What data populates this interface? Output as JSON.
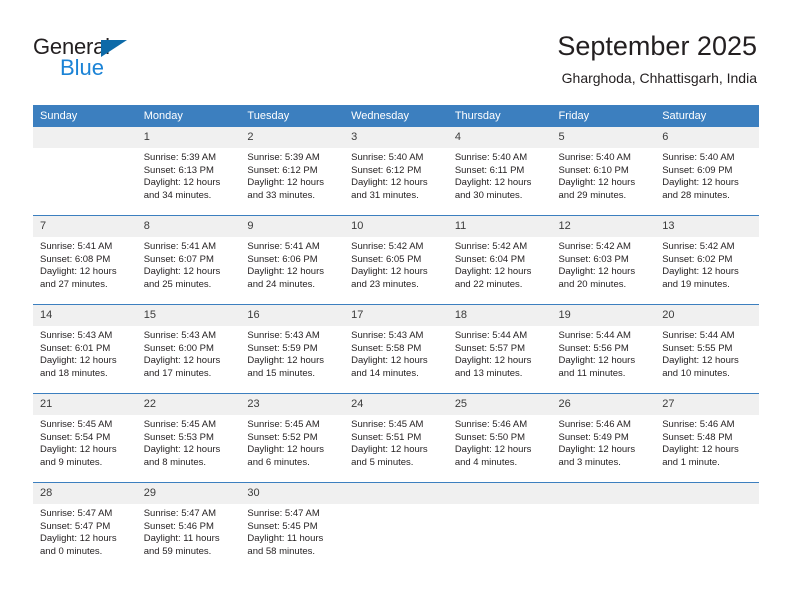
{
  "brand": {
    "name_part1": "General",
    "name_part2": "Blue",
    "accent_color": "#1b83d6",
    "triangle_color": "#0d6aa8"
  },
  "header": {
    "title": "September 2025",
    "subtitle": "Gharghoda, Chhattisgarh, India"
  },
  "calendar": {
    "header_bg": "#3c7fbf",
    "daynum_bg": "#f0f0f0",
    "weekday_headers": [
      "Sunday",
      "Monday",
      "Tuesday",
      "Wednesday",
      "Thursday",
      "Friday",
      "Saturday"
    ],
    "weeks": [
      [
        {
          "day": "",
          "sunrise": "",
          "sunset": "",
          "daylight1": "",
          "daylight2": ""
        },
        {
          "day": "1",
          "sunrise": "Sunrise: 5:39 AM",
          "sunset": "Sunset: 6:13 PM",
          "daylight1": "Daylight: 12 hours",
          "daylight2": "and 34 minutes."
        },
        {
          "day": "2",
          "sunrise": "Sunrise: 5:39 AM",
          "sunset": "Sunset: 6:12 PM",
          "daylight1": "Daylight: 12 hours",
          "daylight2": "and 33 minutes."
        },
        {
          "day": "3",
          "sunrise": "Sunrise: 5:40 AM",
          "sunset": "Sunset: 6:12 PM",
          "daylight1": "Daylight: 12 hours",
          "daylight2": "and 31 minutes."
        },
        {
          "day": "4",
          "sunrise": "Sunrise: 5:40 AM",
          "sunset": "Sunset: 6:11 PM",
          "daylight1": "Daylight: 12 hours",
          "daylight2": "and 30 minutes."
        },
        {
          "day": "5",
          "sunrise": "Sunrise: 5:40 AM",
          "sunset": "Sunset: 6:10 PM",
          "daylight1": "Daylight: 12 hours",
          "daylight2": "and 29 minutes."
        },
        {
          "day": "6",
          "sunrise": "Sunrise: 5:40 AM",
          "sunset": "Sunset: 6:09 PM",
          "daylight1": "Daylight: 12 hours",
          "daylight2": "and 28 minutes."
        }
      ],
      [
        {
          "day": "7",
          "sunrise": "Sunrise: 5:41 AM",
          "sunset": "Sunset: 6:08 PM",
          "daylight1": "Daylight: 12 hours",
          "daylight2": "and 27 minutes."
        },
        {
          "day": "8",
          "sunrise": "Sunrise: 5:41 AM",
          "sunset": "Sunset: 6:07 PM",
          "daylight1": "Daylight: 12 hours",
          "daylight2": "and 25 minutes."
        },
        {
          "day": "9",
          "sunrise": "Sunrise: 5:41 AM",
          "sunset": "Sunset: 6:06 PM",
          "daylight1": "Daylight: 12 hours",
          "daylight2": "and 24 minutes."
        },
        {
          "day": "10",
          "sunrise": "Sunrise: 5:42 AM",
          "sunset": "Sunset: 6:05 PM",
          "daylight1": "Daylight: 12 hours",
          "daylight2": "and 23 minutes."
        },
        {
          "day": "11",
          "sunrise": "Sunrise: 5:42 AM",
          "sunset": "Sunset: 6:04 PM",
          "daylight1": "Daylight: 12 hours",
          "daylight2": "and 22 minutes."
        },
        {
          "day": "12",
          "sunrise": "Sunrise: 5:42 AM",
          "sunset": "Sunset: 6:03 PM",
          "daylight1": "Daylight: 12 hours",
          "daylight2": "and 20 minutes."
        },
        {
          "day": "13",
          "sunrise": "Sunrise: 5:42 AM",
          "sunset": "Sunset: 6:02 PM",
          "daylight1": "Daylight: 12 hours",
          "daylight2": "and 19 minutes."
        }
      ],
      [
        {
          "day": "14",
          "sunrise": "Sunrise: 5:43 AM",
          "sunset": "Sunset: 6:01 PM",
          "daylight1": "Daylight: 12 hours",
          "daylight2": "and 18 minutes."
        },
        {
          "day": "15",
          "sunrise": "Sunrise: 5:43 AM",
          "sunset": "Sunset: 6:00 PM",
          "daylight1": "Daylight: 12 hours",
          "daylight2": "and 17 minutes."
        },
        {
          "day": "16",
          "sunrise": "Sunrise: 5:43 AM",
          "sunset": "Sunset: 5:59 PM",
          "daylight1": "Daylight: 12 hours",
          "daylight2": "and 15 minutes."
        },
        {
          "day": "17",
          "sunrise": "Sunrise: 5:43 AM",
          "sunset": "Sunset: 5:58 PM",
          "daylight1": "Daylight: 12 hours",
          "daylight2": "and 14 minutes."
        },
        {
          "day": "18",
          "sunrise": "Sunrise: 5:44 AM",
          "sunset": "Sunset: 5:57 PM",
          "daylight1": "Daylight: 12 hours",
          "daylight2": "and 13 minutes."
        },
        {
          "day": "19",
          "sunrise": "Sunrise: 5:44 AM",
          "sunset": "Sunset: 5:56 PM",
          "daylight1": "Daylight: 12 hours",
          "daylight2": "and 11 minutes."
        },
        {
          "day": "20",
          "sunrise": "Sunrise: 5:44 AM",
          "sunset": "Sunset: 5:55 PM",
          "daylight1": "Daylight: 12 hours",
          "daylight2": "and 10 minutes."
        }
      ],
      [
        {
          "day": "21",
          "sunrise": "Sunrise: 5:45 AM",
          "sunset": "Sunset: 5:54 PM",
          "daylight1": "Daylight: 12 hours",
          "daylight2": "and 9 minutes."
        },
        {
          "day": "22",
          "sunrise": "Sunrise: 5:45 AM",
          "sunset": "Sunset: 5:53 PM",
          "daylight1": "Daylight: 12 hours",
          "daylight2": "and 8 minutes."
        },
        {
          "day": "23",
          "sunrise": "Sunrise: 5:45 AM",
          "sunset": "Sunset: 5:52 PM",
          "daylight1": "Daylight: 12 hours",
          "daylight2": "and 6 minutes."
        },
        {
          "day": "24",
          "sunrise": "Sunrise: 5:45 AM",
          "sunset": "Sunset: 5:51 PM",
          "daylight1": "Daylight: 12 hours",
          "daylight2": "and 5 minutes."
        },
        {
          "day": "25",
          "sunrise": "Sunrise: 5:46 AM",
          "sunset": "Sunset: 5:50 PM",
          "daylight1": "Daylight: 12 hours",
          "daylight2": "and 4 minutes."
        },
        {
          "day": "26",
          "sunrise": "Sunrise: 5:46 AM",
          "sunset": "Sunset: 5:49 PM",
          "daylight1": "Daylight: 12 hours",
          "daylight2": "and 3 minutes."
        },
        {
          "day": "27",
          "sunrise": "Sunrise: 5:46 AM",
          "sunset": "Sunset: 5:48 PM",
          "daylight1": "Daylight: 12 hours",
          "daylight2": "and 1 minute."
        }
      ],
      [
        {
          "day": "28",
          "sunrise": "Sunrise: 5:47 AM",
          "sunset": "Sunset: 5:47 PM",
          "daylight1": "Daylight: 12 hours",
          "daylight2": "and 0 minutes."
        },
        {
          "day": "29",
          "sunrise": "Sunrise: 5:47 AM",
          "sunset": "Sunset: 5:46 PM",
          "daylight1": "Daylight: 11 hours",
          "daylight2": "and 59 minutes."
        },
        {
          "day": "30",
          "sunrise": "Sunrise: 5:47 AM",
          "sunset": "Sunset: 5:45 PM",
          "daylight1": "Daylight: 11 hours",
          "daylight2": "and 58 minutes."
        },
        {
          "day": "",
          "sunrise": "",
          "sunset": "",
          "daylight1": "",
          "daylight2": ""
        },
        {
          "day": "",
          "sunrise": "",
          "sunset": "",
          "daylight1": "",
          "daylight2": ""
        },
        {
          "day": "",
          "sunrise": "",
          "sunset": "",
          "daylight1": "",
          "daylight2": ""
        },
        {
          "day": "",
          "sunrise": "",
          "sunset": "",
          "daylight1": "",
          "daylight2": ""
        }
      ]
    ]
  }
}
